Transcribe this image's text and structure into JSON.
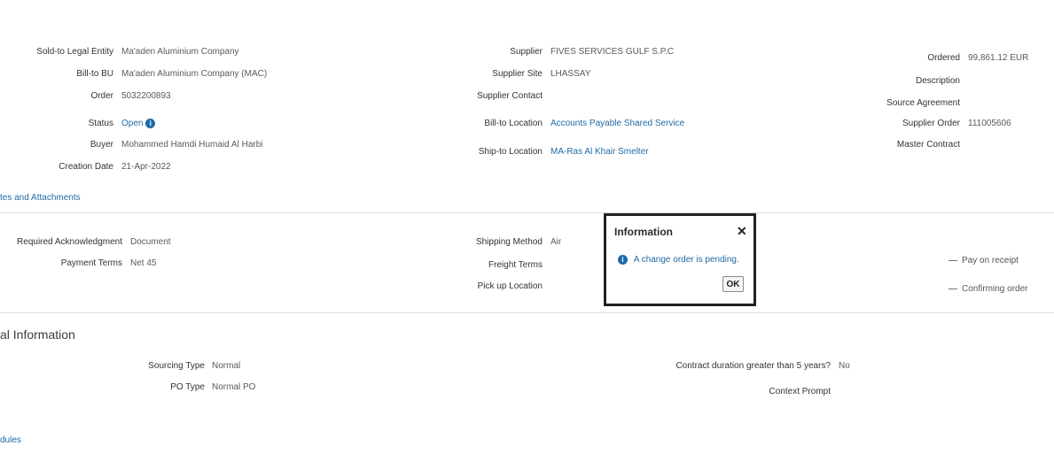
{
  "header": {
    "left": [
      {
        "label": "Sold-to Legal Entity",
        "value": "Ma'aden Aluminium Company"
      },
      {
        "label": "Bill-to BU",
        "value": "Ma'aden Aluminium Company (MAC)"
      },
      {
        "label": "Order",
        "value": "5032200893"
      },
      {
        "label": "Status",
        "value": "Open"
      },
      {
        "label": "Buyer",
        "value": "Mohammed Hamdi Humaid Al Harbi"
      },
      {
        "label": "Creation Date",
        "value": "21-Apr-2022"
      }
    ],
    "middle": [
      {
        "label": "Supplier",
        "value": "FIVES SERVICES GULF S.P.C"
      },
      {
        "label": "Supplier Site",
        "value": "LHASSAY"
      },
      {
        "label": "Supplier Contact",
        "value": ""
      },
      {
        "label": "Bill-to Location",
        "value": "Accounts Payable Shared Service"
      },
      {
        "label": "Ship-to Location",
        "value": "MA-Ras Al Khair Smelter"
      }
    ],
    "right": [
      {
        "label": "Ordered",
        "value": "99,861.12 EUR"
      },
      {
        "label": "Description",
        "value": ""
      },
      {
        "label": "Source Agreement",
        "value": ""
      },
      {
        "label": "Supplier Order",
        "value": "111005606"
      },
      {
        "label": "Master Contract",
        "value": ""
      }
    ],
    "status_info_icon": "i"
  },
  "notes_link": "tes and Attachments",
  "terms": {
    "left": [
      {
        "label": "Required Acknowledgment",
        "value": "Document"
      },
      {
        "label": "Payment Terms",
        "value": "Net 45"
      }
    ],
    "middle": [
      {
        "label": "Shipping Method",
        "value": "Air"
      },
      {
        "label": "Freight Terms",
        "value": ""
      },
      {
        "label": "Pick up Location",
        "value": ""
      }
    ],
    "right": [
      {
        "label": "Pay on receipt"
      },
      {
        "label": "Confirming order"
      }
    ]
  },
  "additional": {
    "heading": "al Information",
    "left": [
      {
        "label": "Sourcing Type",
        "value": "Normal"
      },
      {
        "label": "PO Type",
        "value": "Normal PO"
      }
    ],
    "right": [
      {
        "label": "Contract duration greater than 5 years?",
        "value": "No"
      },
      {
        "label": "Context Prompt",
        "value": ""
      }
    ]
  },
  "schedules_link": "dules",
  "dialog": {
    "title": "Information",
    "close_glyph": "✕",
    "info_glyph": "i",
    "message": "A change order is pending.",
    "ok_label": "OK"
  },
  "colors": {
    "link": "#1f6aa6",
    "dialog_border": "#222222"
  }
}
